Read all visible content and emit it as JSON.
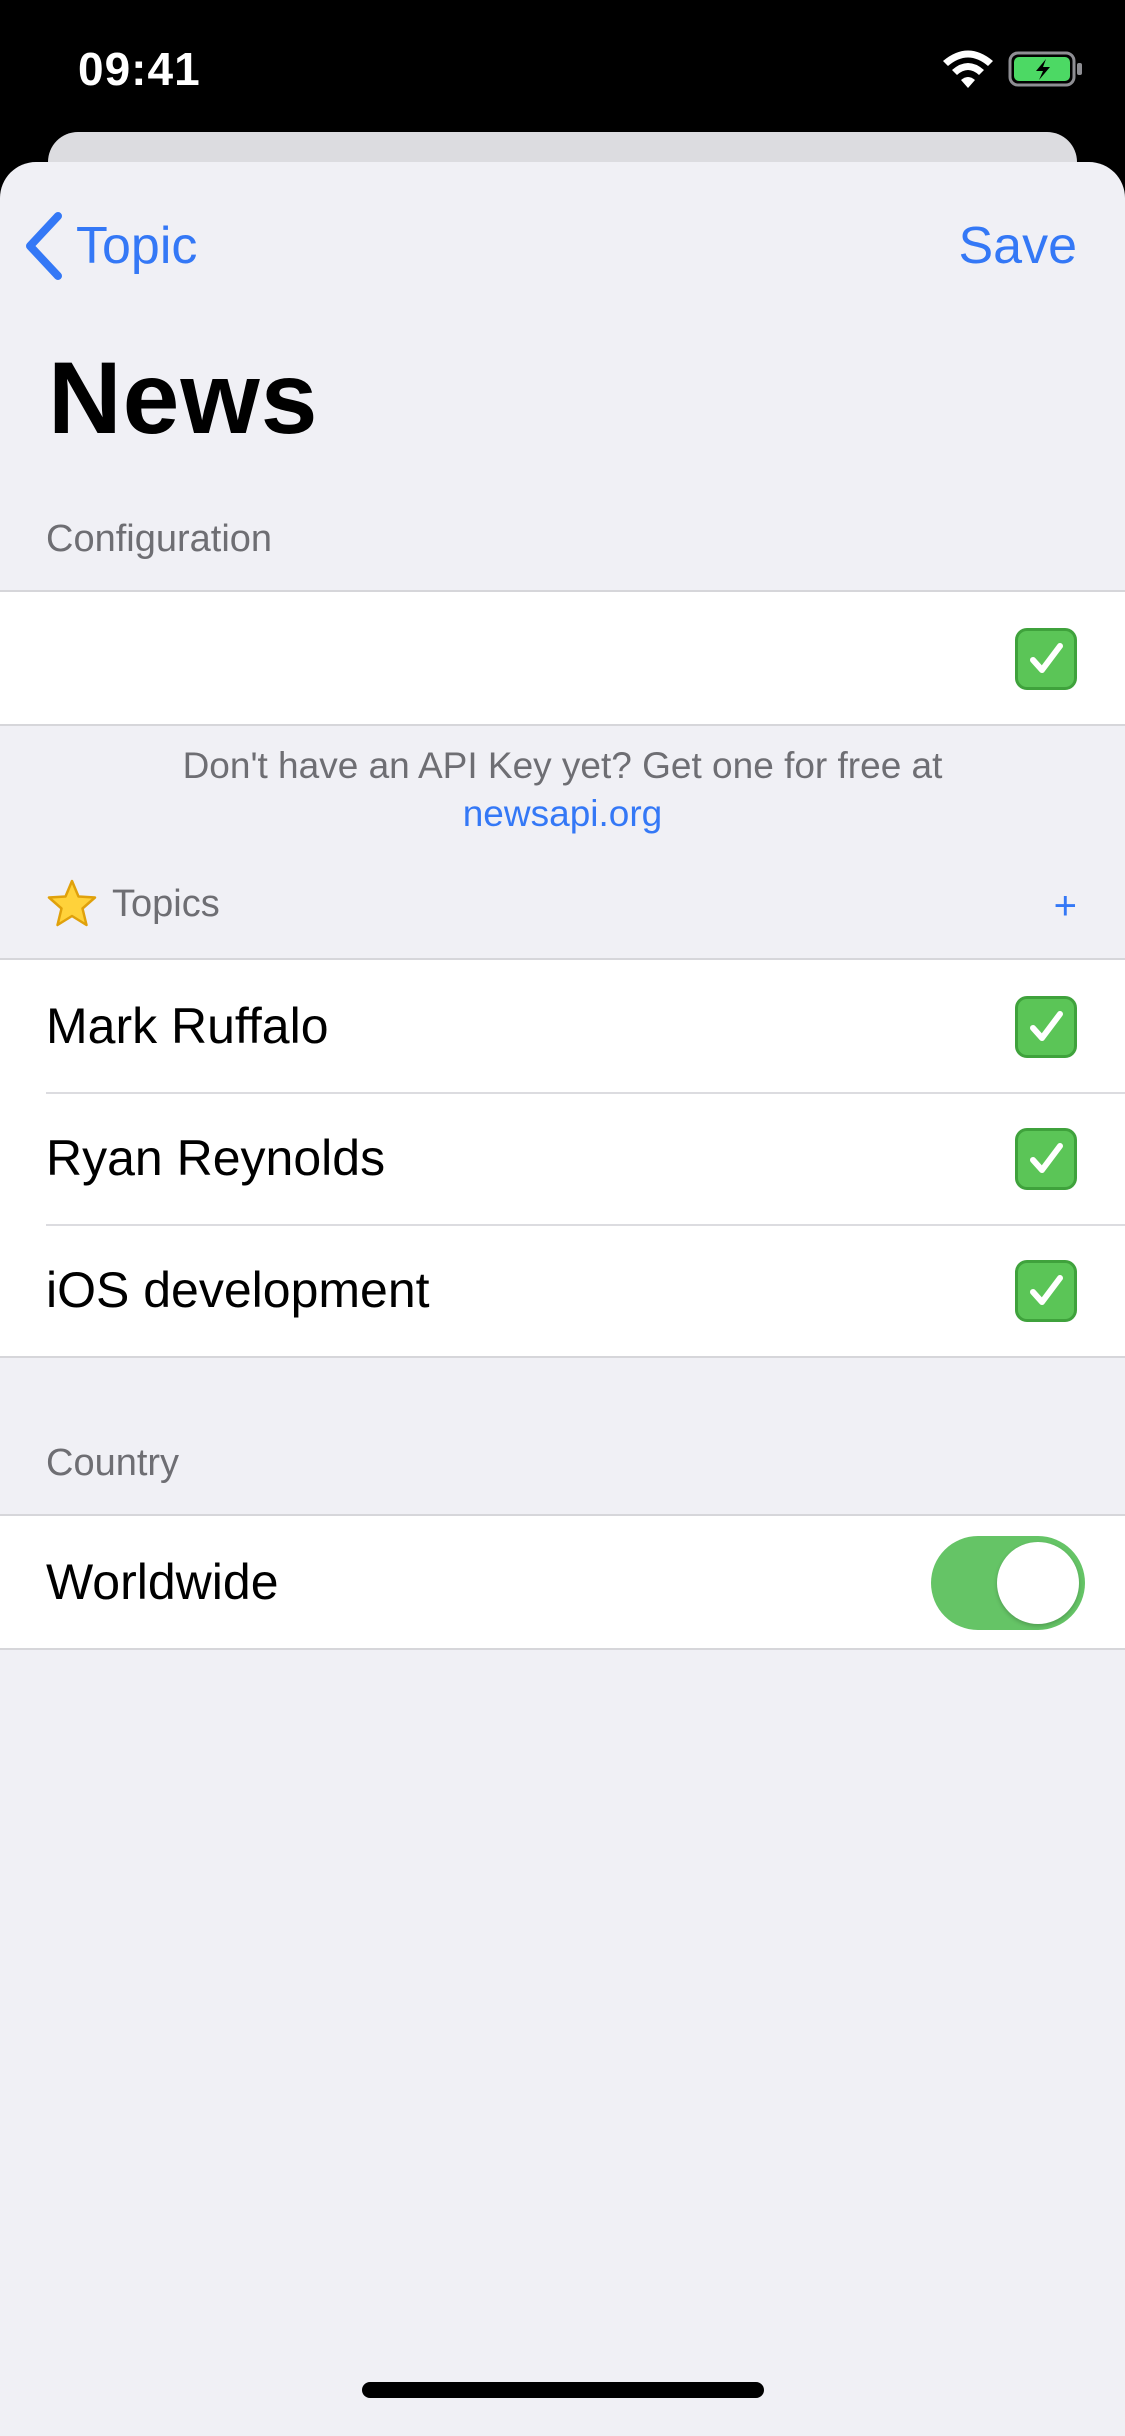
{
  "status_bar": {
    "time": "09:41"
  },
  "nav": {
    "back_label": "Topic",
    "save_label": "Save"
  },
  "title": "News",
  "configuration": {
    "header": "Configuration",
    "api_key_value": "",
    "api_key_valid": true,
    "footer_text": "Don't have an API Key yet? Get one for free at",
    "footer_link": "newsapi.org"
  },
  "topics": {
    "header": "Topics",
    "header_icon": "star-icon",
    "add_label": "+",
    "items": [
      {
        "label": "Mark Ruffalo",
        "checked": true
      },
      {
        "label": "Ryan Reynolds",
        "checked": true
      },
      {
        "label": "iOS development",
        "checked": true
      }
    ]
  },
  "country": {
    "header": "Country",
    "worldwide_label": "Worldwide",
    "worldwide_on": true
  },
  "colors": {
    "accent": "#3478f6",
    "toggle_on": "#65c466",
    "check_green": "#5bc557",
    "background": "#f0f0f5"
  }
}
